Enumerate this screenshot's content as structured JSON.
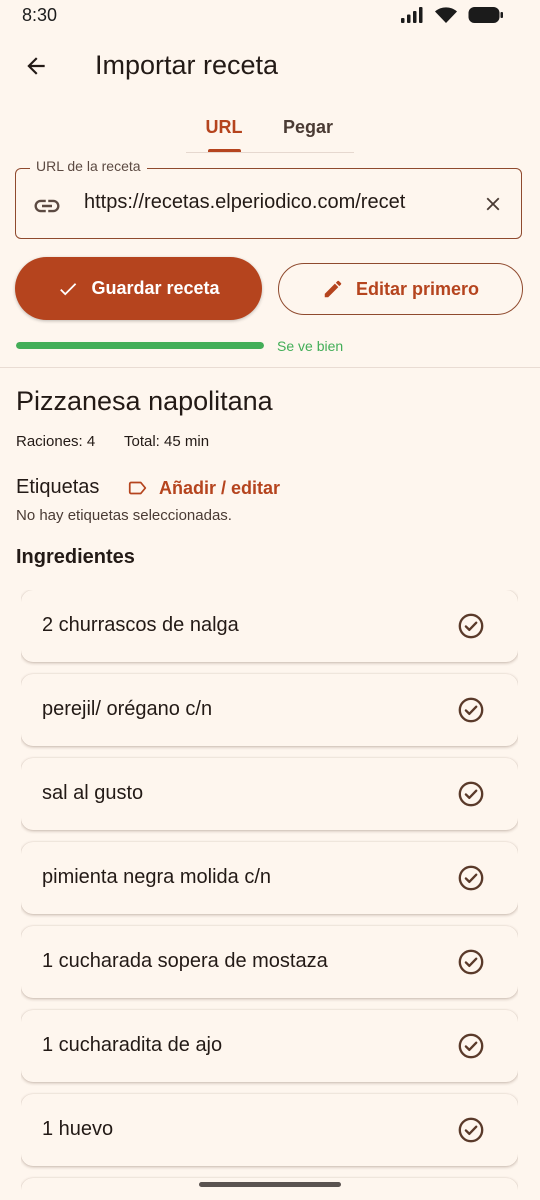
{
  "status_bar": {
    "time": "8:30"
  },
  "app_bar": {
    "title": "Importar receta"
  },
  "tabs": [
    {
      "label": "URL",
      "selected": true
    },
    {
      "label": "Pegar",
      "selected": false
    }
  ],
  "url_field": {
    "label": "URL de la receta",
    "value": "https://recetas.elperiodico.com/recet"
  },
  "actions": {
    "save_label": "Guardar receta",
    "edit_label": "Editar primero"
  },
  "status": {
    "label": "Se ve bien",
    "progress": 1.0
  },
  "recipe": {
    "title": "Pizzanesa napolitana",
    "servings": "Raciones: 4",
    "total": "Total: 45 min"
  },
  "tags": {
    "heading": "Etiquetas",
    "edit_label": "Añadir / editar",
    "empty_text": "No hay etiquetas seleccionadas."
  },
  "ingredients": {
    "heading": "Ingredientes",
    "items": [
      "2 churrascos de nalga",
      "perejil/ orégano c/n",
      "sal al gusto",
      "pimienta negra molida c/n",
      "1 cucharada sopera de mostaza",
      "1 cucharadita de ajo",
      "1 huevo",
      ""
    ]
  },
  "colors": {
    "background": "#FEF6EE",
    "primary": "#B5441E",
    "outline": "#8F4A2E",
    "success": "#43AE58",
    "check": "#5A3A2A"
  },
  "icons": {
    "back": "arrow-left-icon",
    "link": "link-icon",
    "clear": "close-icon",
    "save": "check-icon",
    "edit": "pencil-icon",
    "tag": "label-icon",
    "ingredient": "check-circle-icon"
  }
}
